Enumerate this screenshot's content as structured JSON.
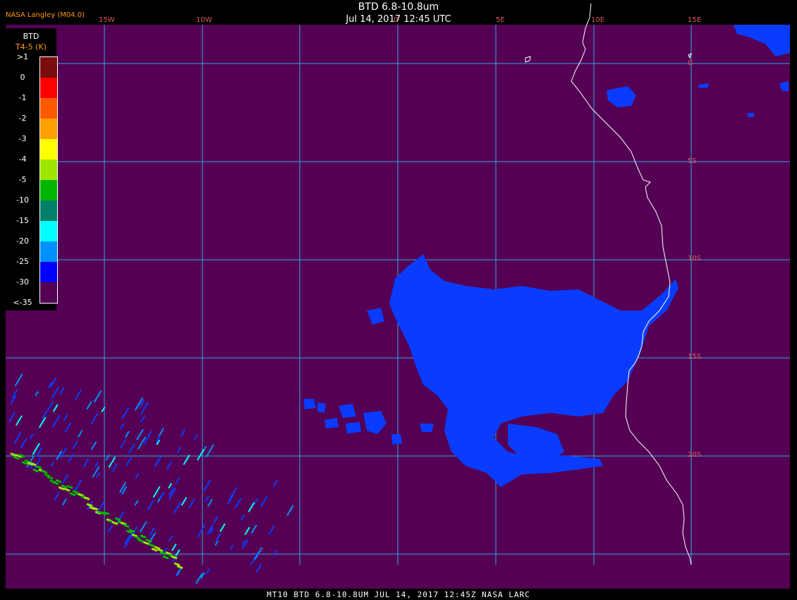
{
  "header": {
    "title": "BTD 6.8-10.8um",
    "date": "Jul 14, 2017 12:45 UTC",
    "org": "NASA Langley (M04.0)"
  },
  "footer": "MT10  BTD 6.8-10.8UM   JUL 14, 2017 12:45Z   NASA LARC",
  "legend": {
    "title": "BTD",
    "subtitle": "T4-5 (K)",
    "labels": [
      ">1",
      "0",
      "-1",
      "-2",
      "-3",
      "-4",
      "-5",
      "-10",
      "-15",
      "-20",
      "-25",
      "-30",
      "<-35"
    ],
    "colors": [
      "#7a0d0d",
      "#ff0000",
      "#ff5a00",
      "#ffa000",
      "#ffff00",
      "#9ee600",
      "#00b400",
      "#00806a",
      "#00ffff",
      "#0090ff",
      "#0000ff",
      "#540054"
    ]
  },
  "grid": {
    "lon_labels": [
      "15W",
      "10W",
      "0",
      "5E",
      "10E",
      "15E"
    ],
    "lat_labels": [
      "0",
      "5S",
      "10S",
      "15S",
      "20S"
    ]
  },
  "colors": {
    "background": "#540054",
    "grid": "#35a9df",
    "cloud": "#0a3cff",
    "coast": "#ffffff",
    "label_red": "#e05a5a",
    "label_orange": "#ff9a00"
  }
}
